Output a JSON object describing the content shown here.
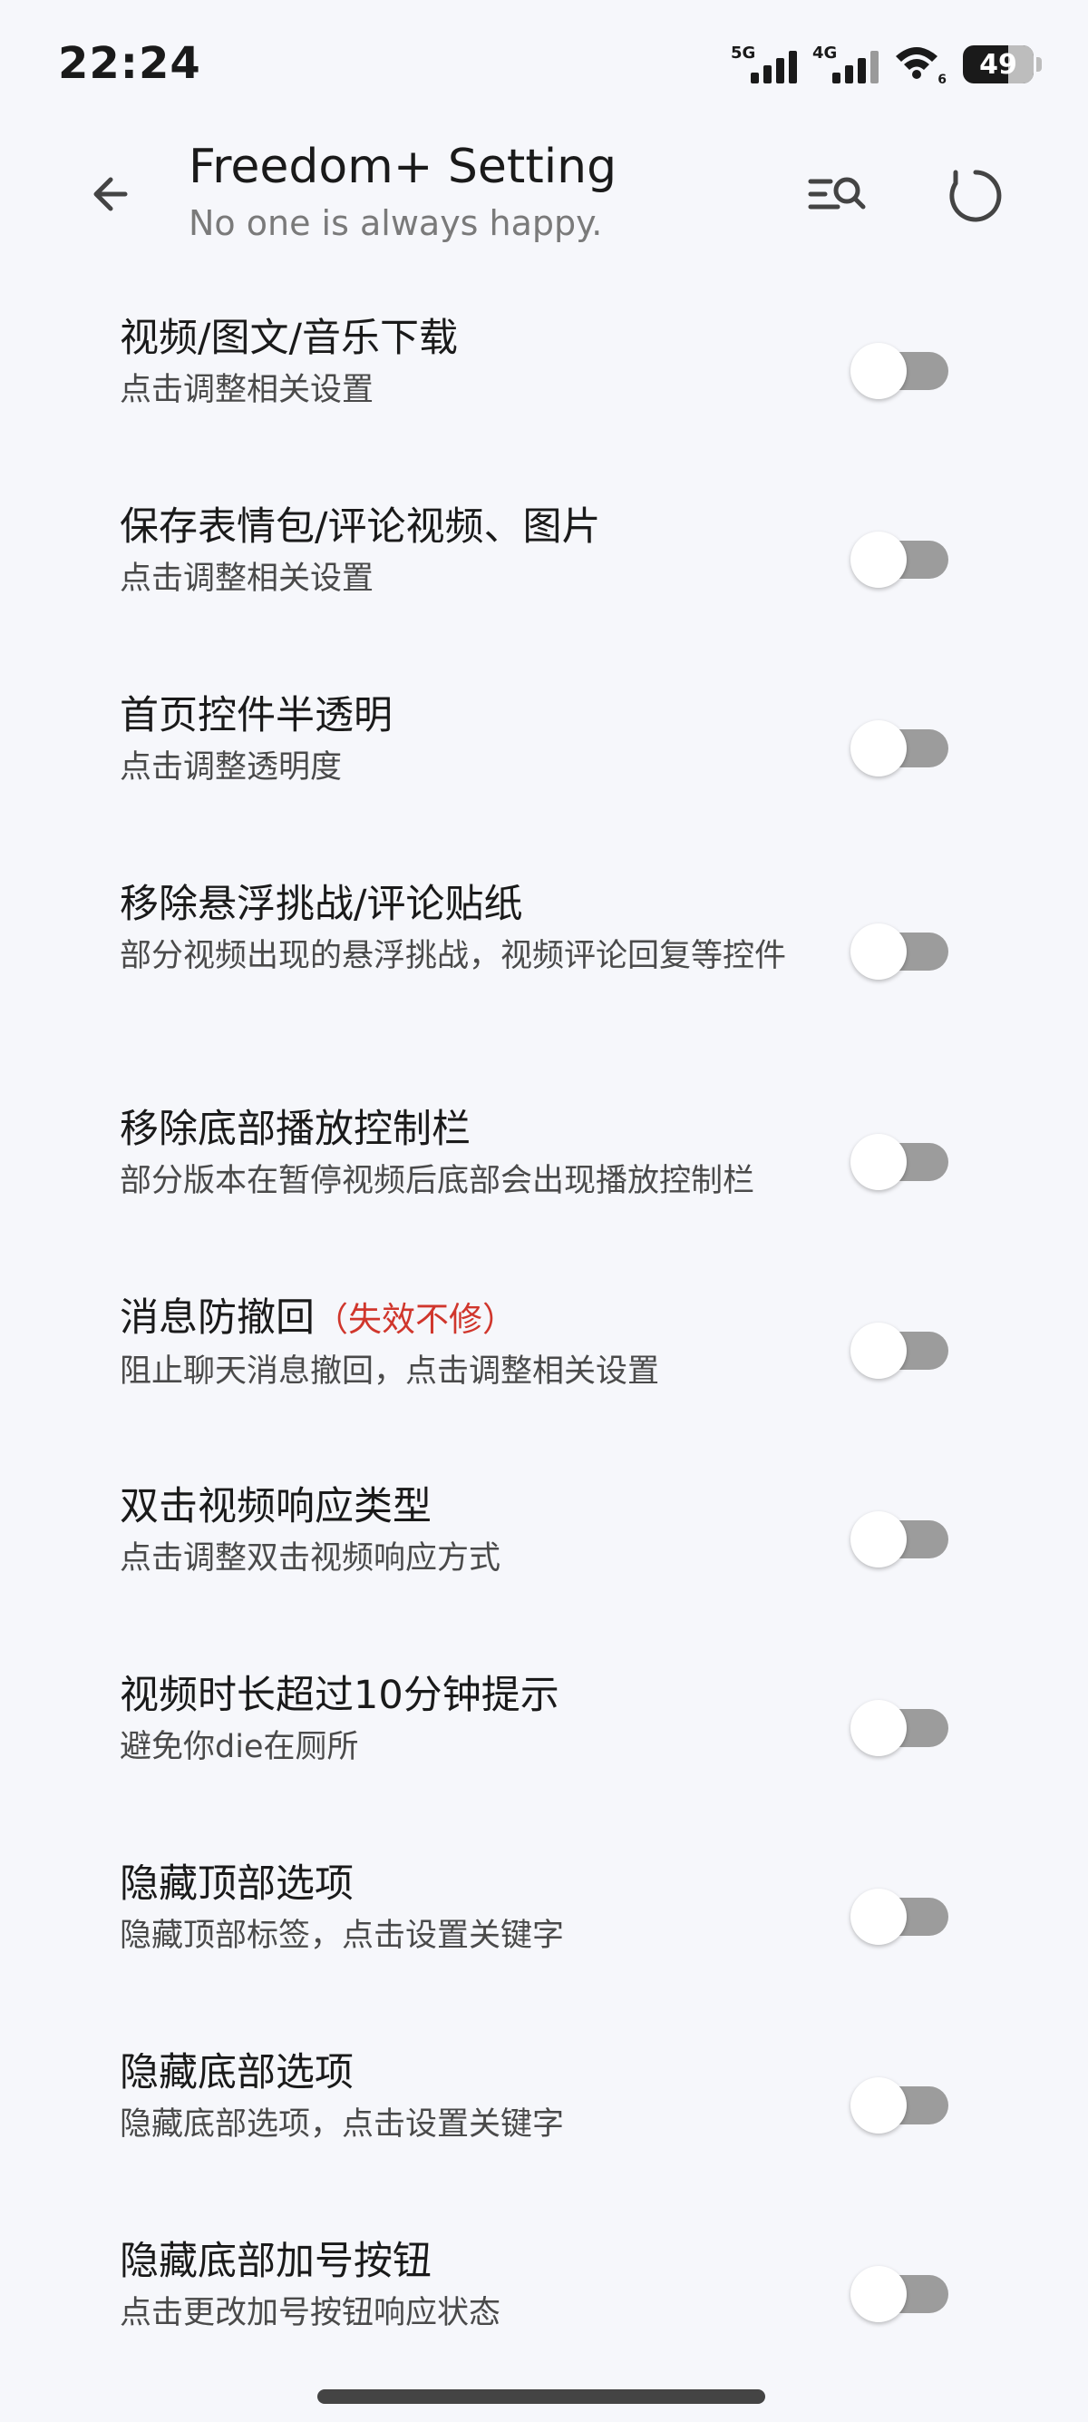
{
  "status": {
    "time": "22:24",
    "net1": "5G",
    "net2": "4G",
    "wifi_sub": "6",
    "battery": "49"
  },
  "header": {
    "title": "Freedom+ Setting",
    "subtitle": "No one is always happy.",
    "back_icon": "back-arrow-icon",
    "search_icon": "list-search-icon",
    "reset_icon": "refresh-icon"
  },
  "settings": [
    {
      "title": "视频/图文/音乐下载",
      "subtitle": "点击调整相关设置",
      "enabled": false
    },
    {
      "title": "保存表情包/评论视频、图片",
      "subtitle": "点击调整相关设置",
      "enabled": false
    },
    {
      "title": "首页控件半透明",
      "subtitle": "点击调整透明度",
      "enabled": false
    },
    {
      "title": "移除悬浮挑战/评论贴纸",
      "subtitle": "部分视频出现的悬浮挑战，视频评论回复等控件",
      "enabled": false
    },
    {
      "title": "移除底部播放控制栏",
      "subtitle": "部分版本在暂停视频后底部会出现播放控制栏",
      "enabled": false
    },
    {
      "title": "消息防撤回",
      "title_suffix": "（失效不修）",
      "subtitle": "阻止聊天消息撤回，点击调整相关设置",
      "enabled": false
    },
    {
      "title": "双击视频响应类型",
      "subtitle": "点击调整双击视频响应方式",
      "enabled": false
    },
    {
      "title": "视频时长超过10分钟提示",
      "subtitle": "避免你die在厕所",
      "enabled": false
    },
    {
      "title": "隐藏顶部选项",
      "subtitle": "隐藏顶部标签，点击设置关键字",
      "enabled": false
    },
    {
      "title": "隐藏底部选项",
      "subtitle": "隐藏底部选项，点击设置关键字",
      "enabled": false
    },
    {
      "title": "隐藏底部加号按钮",
      "subtitle": "点击更改加号按钮响应状态",
      "enabled": false
    }
  ],
  "colors": {
    "background": "#f6f7fb",
    "warning": "#d0362c",
    "toggle_off": "#9c9c9c"
  }
}
